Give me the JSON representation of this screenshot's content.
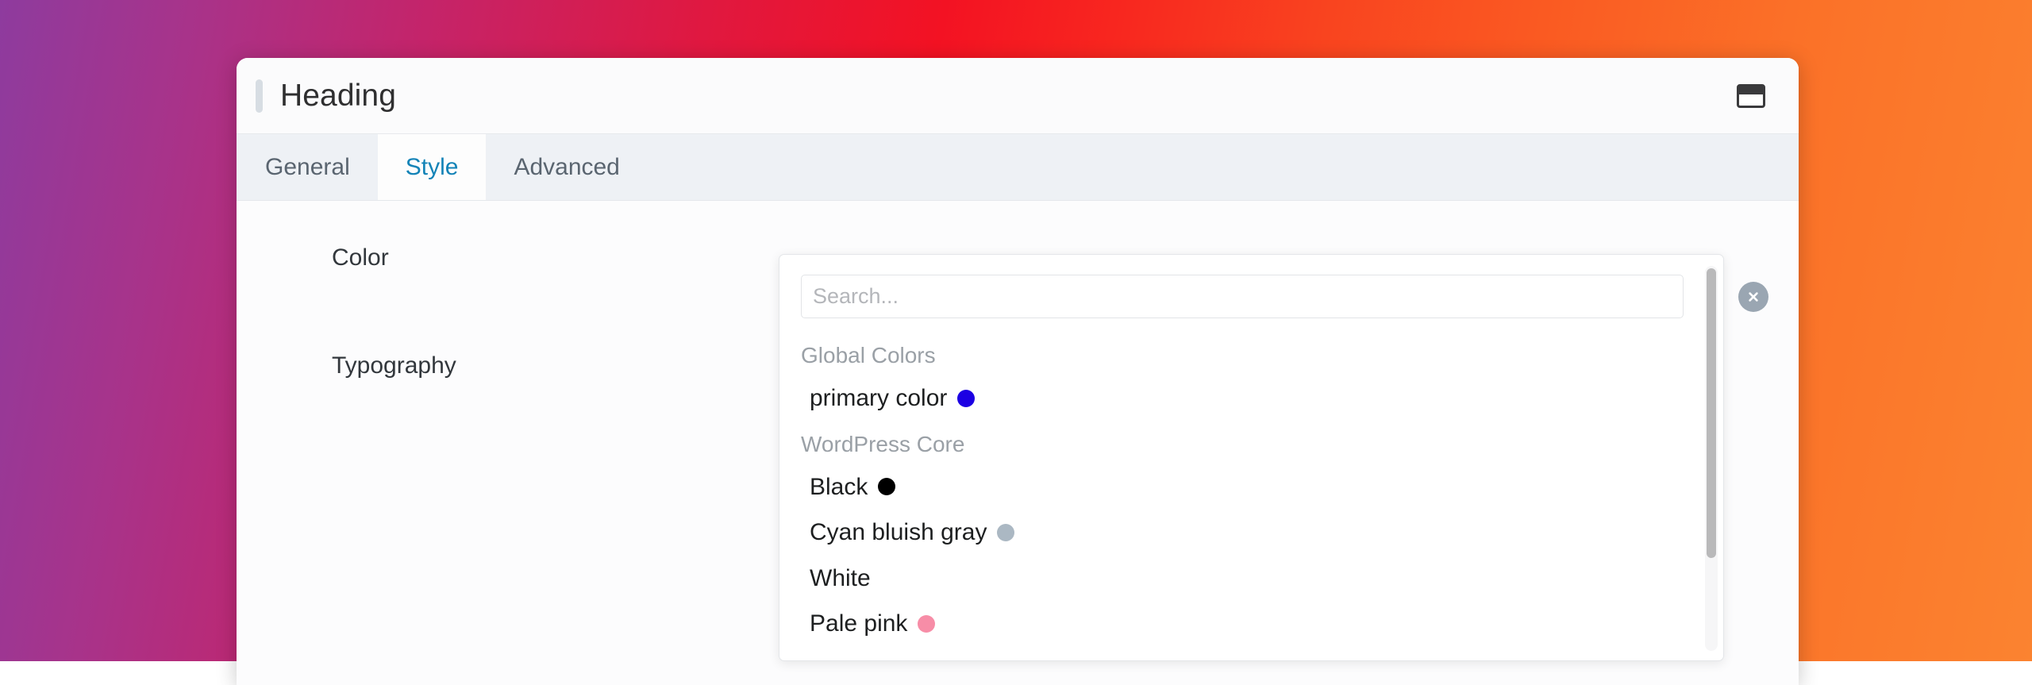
{
  "window": {
    "title": "Heading",
    "drag_handle_name": "drag-handle",
    "layout_toggle_icon": "window-layout-icon"
  },
  "tabs": [
    {
      "label": "General",
      "active": false
    },
    {
      "label": "Style",
      "active": true
    },
    {
      "label": "Advanced",
      "active": false
    }
  ],
  "fields": [
    {
      "label": "Color",
      "has_device_icon": false
    },
    {
      "label": "Typography",
      "has_device_icon": true,
      "device_icon": "desktop-monitor-icon"
    }
  ],
  "color_dropdown": {
    "search": {
      "placeholder": "Search...",
      "value": ""
    },
    "groups": [
      {
        "title": "Global Colors",
        "items": [
          {
            "label": "primary color",
            "swatch": "#1c00e3"
          }
        ]
      },
      {
        "title": "WordPress Core",
        "items": [
          {
            "label": "Black",
            "swatch": "#000000"
          },
          {
            "label": "Cyan bluish gray",
            "swatch": "#abb8c3"
          },
          {
            "label": "White",
            "swatch": "#ffffff"
          },
          {
            "label": "Pale pink",
            "swatch": "#f78da7"
          }
        ]
      }
    ],
    "close_button_icon": "close-icon"
  },
  "theme": {
    "accent_blue": "#1383b7",
    "tab_bar_bg": "#eef1f5",
    "panel_bg": "#fdfdfd",
    "text_primary": "#32373c",
    "text_muted": "#9aa0a6",
    "background_gradient_start": "#8e3b9e",
    "background_gradient_mid": "#f31223",
    "background_gradient_end": "#fb8330"
  }
}
